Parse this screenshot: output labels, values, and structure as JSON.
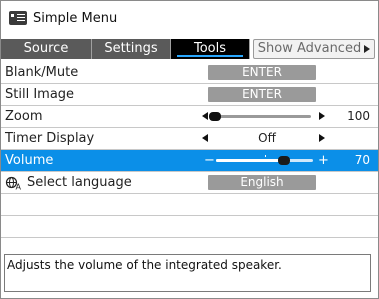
{
  "window": {
    "title": "Simple Menu",
    "icon": "menu-icon"
  },
  "tabs": [
    {
      "label": "Source",
      "selected": false
    },
    {
      "label": "Settings",
      "selected": false
    },
    {
      "label": "Tools",
      "selected": true
    },
    {
      "label": "Show Advanced",
      "selected": false
    }
  ],
  "rows": {
    "blank_mute": {
      "label": "Blank/Mute",
      "action": "ENTER"
    },
    "still_image": {
      "label": "Still Image",
      "action": "ENTER"
    },
    "zoom": {
      "label": "Zoom",
      "value": "100",
      "level": 0.02
    },
    "timer_display": {
      "label": "Timer Display",
      "value": "Off"
    },
    "volume": {
      "label": "Volume",
      "minus": "−",
      "plus": "+",
      "value": "70",
      "level": 0.7
    },
    "select_language": {
      "label": "Select language",
      "value": "English",
      "icon": "language-icon"
    }
  },
  "help_text": "Adjusts the volume of the integrated speaker.",
  "colors": {
    "selected_row": "#0b8fe8",
    "tab_active": "#000000",
    "tab_underline": "#29a8ff",
    "tab_inactive": "#5a5a5a"
  }
}
